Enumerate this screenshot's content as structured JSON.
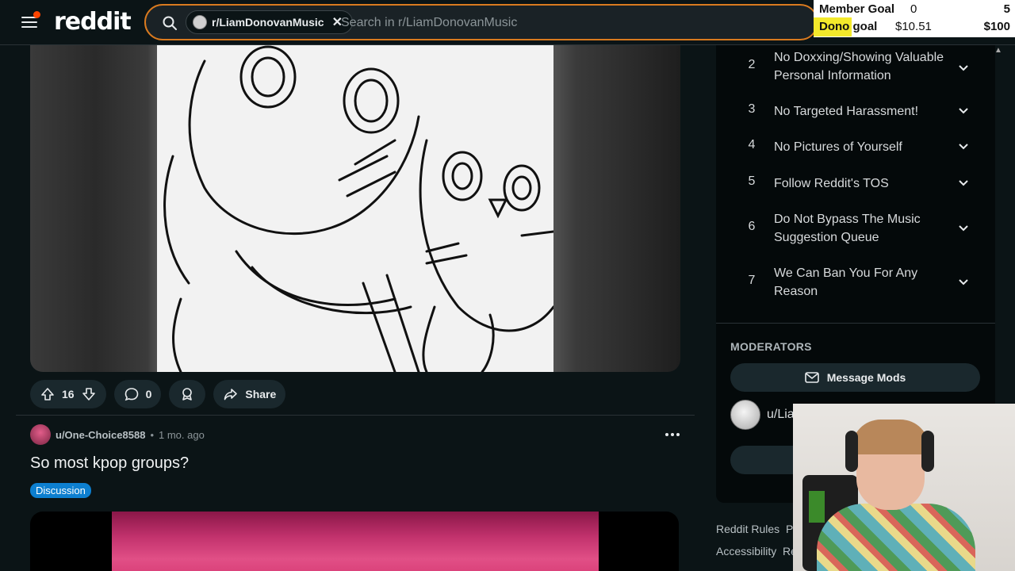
{
  "header": {
    "logo": "reddit",
    "search_chip": "r/LiamDonovanMusic",
    "search_placeholder": "Search in r/LiamDonovanMusic"
  },
  "overlay": {
    "member_goal_label": "Member Goal",
    "member_goal_current": "0",
    "member_goal_max": "5",
    "dono_goal_label": "Dono goal",
    "dono_goal_current": "$10.51",
    "dono_goal_max": "$100",
    "highlight_color": "#f3e92b"
  },
  "post1": {
    "upvotes": "16",
    "comments": "0",
    "share_label": "Share"
  },
  "post2": {
    "username": "u/One-Choice8588",
    "separator": "•",
    "time": "1 mo. ago",
    "title": "So most kpop groups?",
    "flair": "Discussion",
    "flair_color": "#0d7fd0"
  },
  "sidebar": {
    "rules": [
      {
        "num": "2",
        "text": "No Doxxing/Showing Valuable Personal Information"
      },
      {
        "num": "3",
        "text": "No Targeted Harassment!"
      },
      {
        "num": "4",
        "text": "No Pictures of Yourself"
      },
      {
        "num": "5",
        "text": "Follow Reddit's TOS"
      },
      {
        "num": "6",
        "text": "Do Not Bypass The Music Suggestion Queue"
      },
      {
        "num": "7",
        "text": "We Can Ban You For Any Reason"
      }
    ],
    "moderators_title": "MODERATORS",
    "message_mods": "Message Mods",
    "moderator_name": "u/Lia"
  },
  "footer": {
    "link1": "Reddit Rules",
    "link1b": "Pr",
    "link2": "Accessibility",
    "link2b": "Re"
  },
  "accent": "#d97a1f"
}
